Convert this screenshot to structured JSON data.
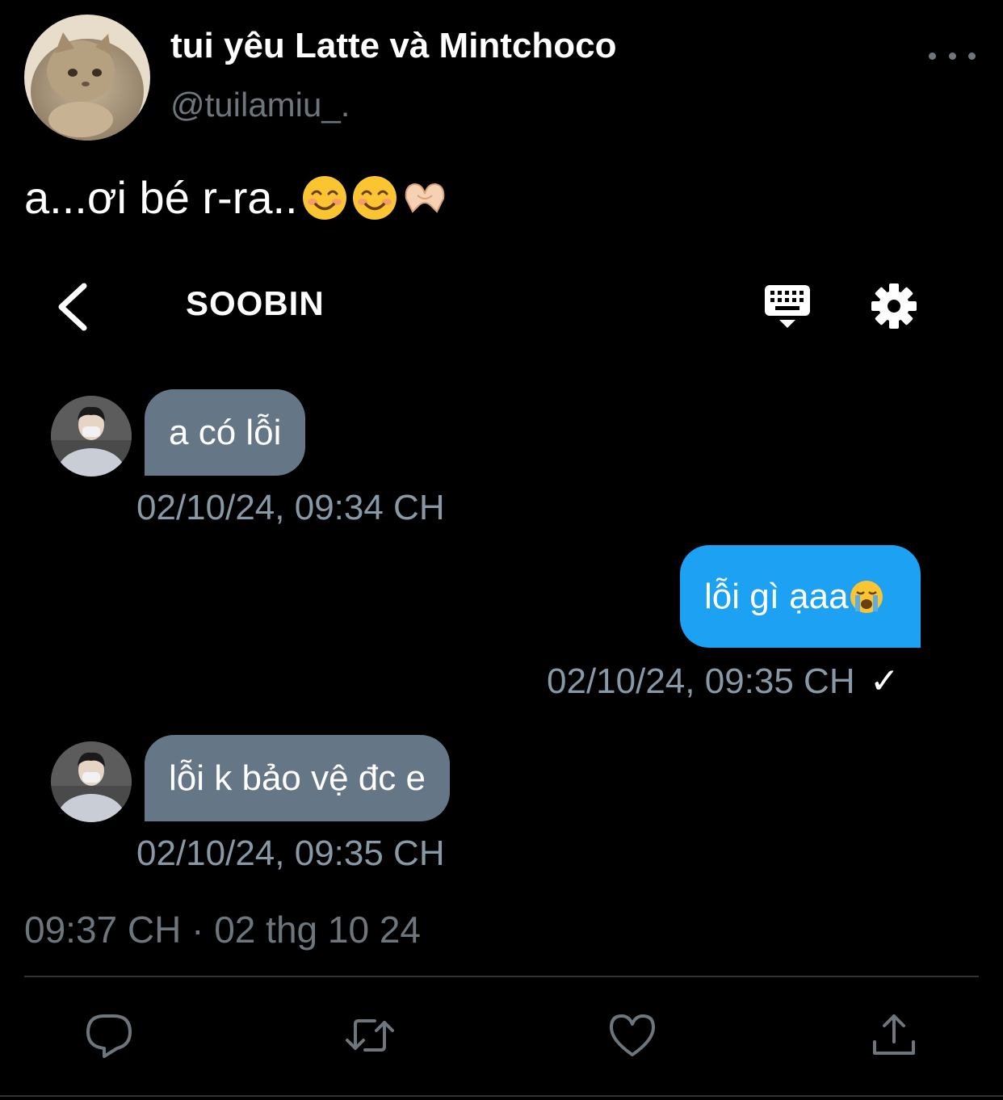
{
  "tweet": {
    "display_name": "tui yêu Latte và Mintchoco",
    "handle": "@tuilamiu_.",
    "text": "a...ơi bé r-ra..",
    "text_emojis": [
      "smiling-face-emoji",
      "smiling-face-emoji",
      "heart-hands-emoji"
    ],
    "timestamp": "09:37 CH · 02 thg 10 24"
  },
  "dm": {
    "contact_name": "SOOBIN",
    "messages": [
      {
        "direction": "incoming",
        "text": "a có lỗi",
        "time": "02/10/24, 09:34 CH"
      },
      {
        "direction": "outgoing",
        "text": "lỗi gì ạaa",
        "emoji": "loudly-crying-face-emoji",
        "time": "02/10/24, 09:35 CH",
        "status": "✓"
      },
      {
        "direction": "incoming",
        "text": "lỗi k bảo vệ đc e",
        "time": "02/10/24, 09:35 CH"
      }
    ]
  },
  "icons": {
    "more": "more-dots-icon",
    "back": "chevron-left-icon",
    "keyboard": "keyboard-icon",
    "settings": "gear-icon",
    "reply": "reply-icon",
    "retweet": "retweet-icon",
    "like": "heart-icon",
    "share": "share-icon"
  },
  "colors": {
    "background": "#000000",
    "accent_blue": "#1da1f2",
    "incoming_bubble": "#657786",
    "secondary_text": "#6e767d",
    "divider": "#2f3336"
  }
}
